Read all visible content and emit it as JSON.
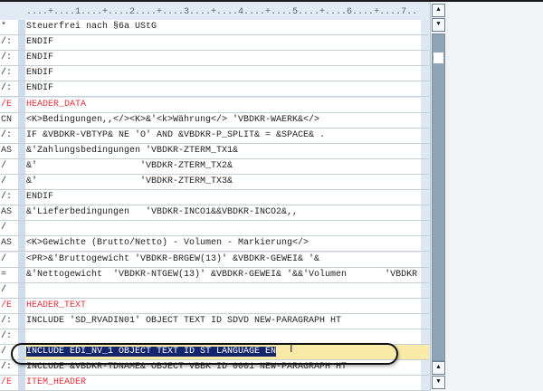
{
  "ruler": "....+....1....+....2....+....3....+....4....+....5....+....6....+....7..",
  "rows": [
    {
      "prefix": "*",
      "text": "Steuerfrei nach §6a UStG"
    },
    {
      "prefix": "/:",
      "text": "ENDIF"
    },
    {
      "prefix": "/:",
      "text": "ENDIF"
    },
    {
      "prefix": "/:",
      "text": "ENDIF"
    },
    {
      "prefix": "/:",
      "text": "ENDIF"
    },
    {
      "prefix": "/E",
      "text": "HEADER_DATA",
      "red": true
    },
    {
      "prefix": "CN",
      "text": "<K>Bedingungen,,</><K>&'<k>Währung</> 'VBDKR-WAERK&</>"
    },
    {
      "prefix": "/:",
      "text": "IF &VBDKR-VBTYP& NE 'O' AND &VBDKR-P_SPLIT& = &SPACE& ."
    },
    {
      "prefix": "AS",
      "text": "&'Zahlungsbedingungen 'VBDKR-ZTERM_TX1&"
    },
    {
      "prefix": "/",
      "text": "&'                   'VBDKR-ZTERM_TX2&"
    },
    {
      "prefix": "/",
      "text": "&'                   'VBDKR-ZTERM_TX3&"
    },
    {
      "prefix": "/:",
      "text": "ENDIF"
    },
    {
      "prefix": "AS",
      "text": "&'Lieferbedingungen   'VBDKR-INCO1&&VBDKR-INCO2&,,"
    },
    {
      "prefix": "/",
      "text": ""
    },
    {
      "prefix": "AS",
      "text": "<K>Gewichte (Brutto/Netto) - Volumen - Markierung</>"
    },
    {
      "prefix": "/",
      "text": "<PR>&'Bruttogewicht 'VBDKR-BRGEW(13)' &VBDKR-GEWEI& '&"
    },
    {
      "prefix": "=",
      "text": "&'Nettogewicht  'VBDKR-NTGEW(13)' &VBDKR-GEWEI& '&&'Volumen       'VBDKR >"
    },
    {
      "prefix": "/",
      "text": ""
    },
    {
      "prefix": "/E",
      "text": "HEADER_TEXT",
      "red": true
    },
    {
      "prefix": "/:",
      "text": "INCLUDE 'SD_RVADIN01' OBJECT TEXT ID SDVD NEW-PARAGRAPH HT"
    },
    {
      "prefix": "/:",
      "text": ""
    },
    {
      "prefix": "/",
      "text": "INCLUDE EDI_NV_1 OBJECT TEXT ID ST LANGUAGE EN",
      "highlighted": true,
      "selected": true
    },
    {
      "prefix": "/:",
      "text": "INCLUDE &VBDKR-TDNAME& OBJECT VBBK ID 0001 NEW-PARAGRAPH HT"
    },
    {
      "prefix": "/E",
      "text": "ITEM_HEADER",
      "red": true
    }
  ],
  "colors": {
    "keyword_red": "#e0303a",
    "highlight_yellow": "#faeaa8",
    "selection_blue": "#13266e"
  },
  "scrollbar": {
    "up_icon": "triangle-up",
    "down_icon": "triangle-down",
    "up": "▲",
    "down": "▼"
  }
}
